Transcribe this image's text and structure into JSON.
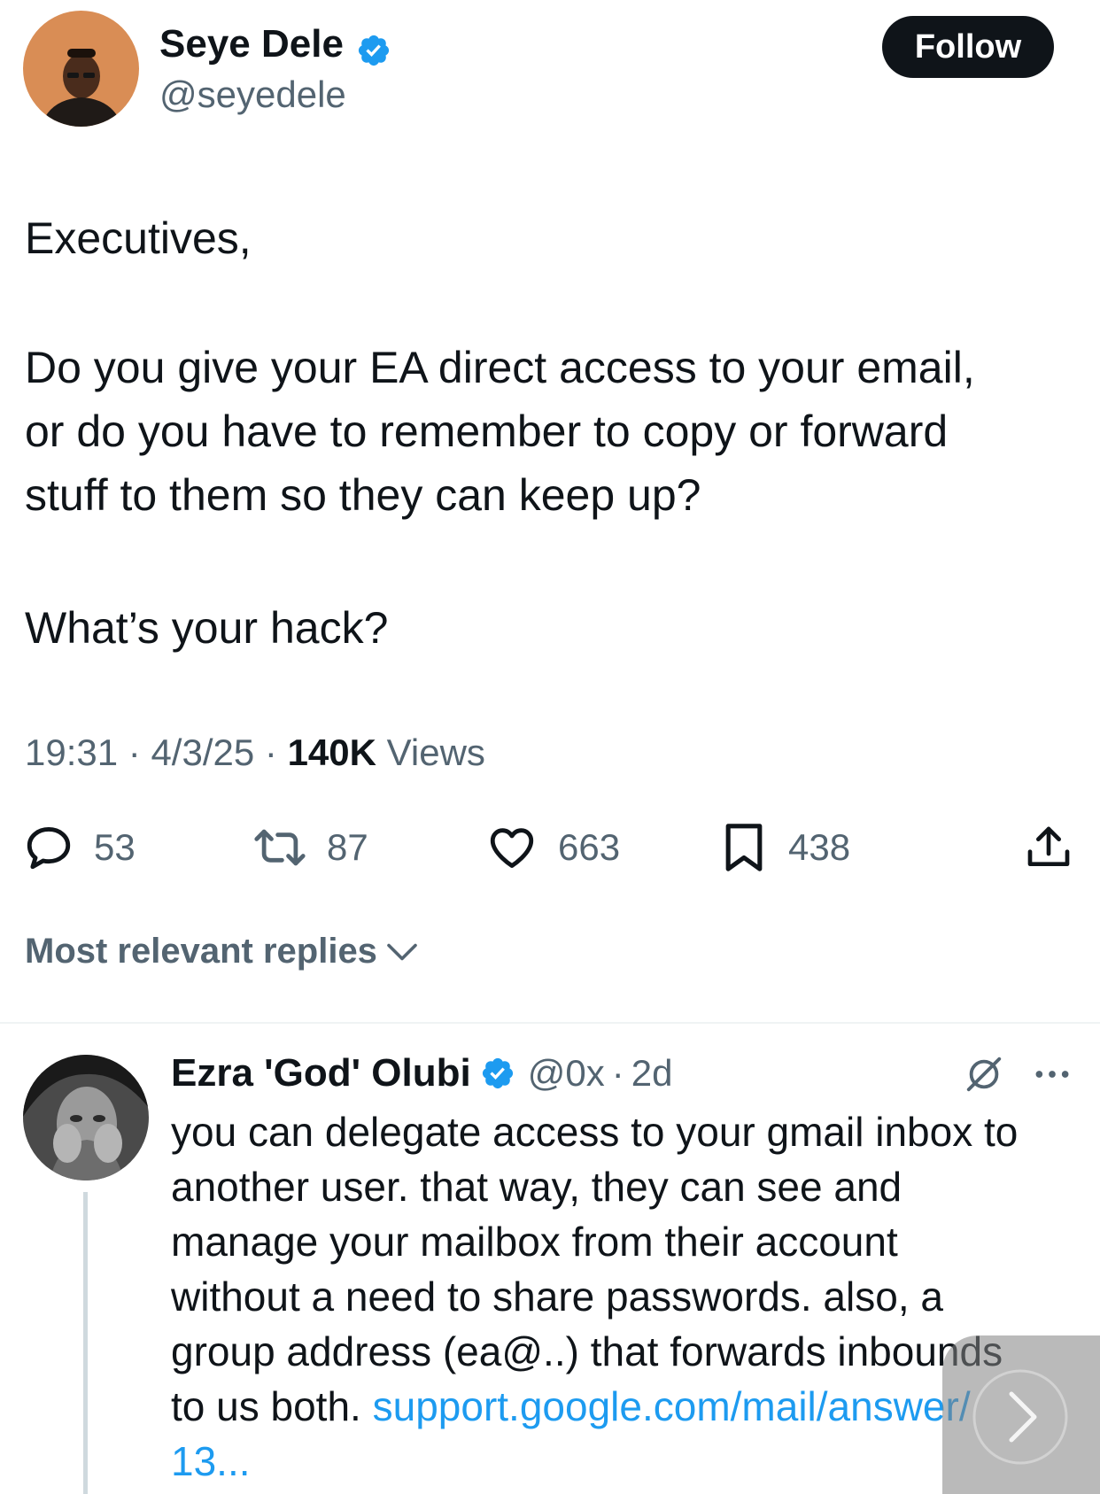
{
  "tweet": {
    "author": {
      "name": "Seye Dele",
      "handle": "@seyedele",
      "verified": true
    },
    "follow_label": "Follow",
    "lines": [
      "Executives,",
      "Do you give your EA direct access to your email,",
      "or do you have to remember to copy or forward",
      "stuff to them so they can keep up?",
      "What’s your hack?"
    ],
    "time": "19:31",
    "separator": "·",
    "date": "4/3/25",
    "views_count": "140K",
    "views_label": "Views",
    "stats": {
      "replies": "53",
      "reposts": "87",
      "likes": "663",
      "bookmarks": "438"
    }
  },
  "replies_sort_label": "Most relevant replies",
  "reply": {
    "author": {
      "name": "Ezra 'God' Olubi",
      "handle": "@0x",
      "verified": true
    },
    "age": "2d",
    "lines": [
      "you can delegate access to your gmail inbox to",
      "another user. that way, they can see and",
      "manage your mailbox from their account",
      "without a need to share passwords. also, a",
      "group address (ea@..) that forwards inbounds"
    ],
    "last_line_prefix": "to us both.",
    "link_text": "support.google.com/mail/answer/",
    "link_continuation": "13..."
  },
  "colors": {
    "text": "#0f1419",
    "secondary": "#536471",
    "accent": "#1d9bf0",
    "follow_bg": "#0f1419",
    "divider": "#eff3f4"
  },
  "icons": [
    "verified-badge-icon",
    "reply-icon",
    "repost-icon",
    "like-icon",
    "bookmark-icon",
    "share-icon",
    "chevron-down-icon",
    "grok-icon",
    "more-icon",
    "chevron-right-icon"
  ]
}
